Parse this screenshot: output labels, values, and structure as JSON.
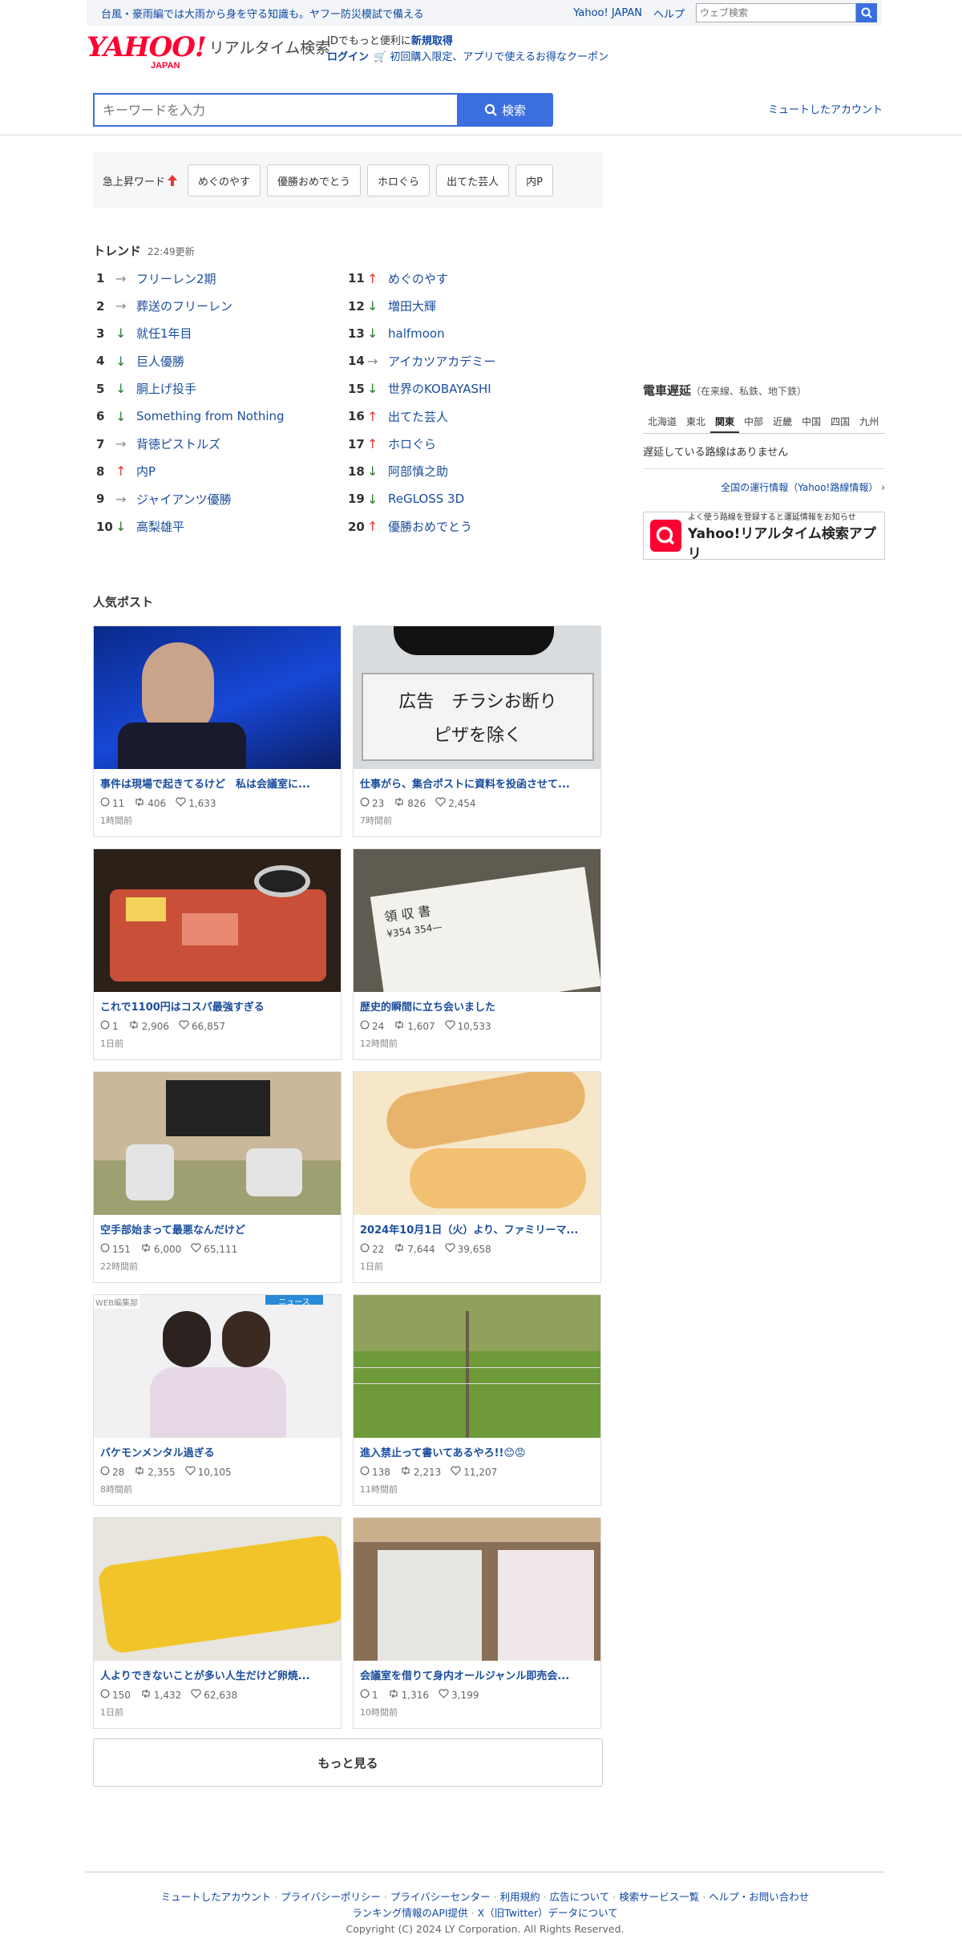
{
  "topbar": {
    "notice": "台風・豪雨編では大雨から身を守る知識も。ヤフー防災模試で備える",
    "yahoo_japan": "Yahoo! JAPAN",
    "help": "ヘルプ",
    "web_search_placeholder": "ウェブ検索"
  },
  "header": {
    "logo_yahoo": "YAHOO!",
    "logo_japan": "JAPAN",
    "logo_product": "リアルタイム検索",
    "id_prefix": "IDでもっと便利に",
    "id_register": "新規取得",
    "login": "ログイン",
    "coupon": "初回購入限定、アプリで使えるお得なクーポン"
  },
  "search": {
    "placeholder": "キーワードを入力",
    "button": "検索",
    "muted_accounts": "ミュートしたアカウント"
  },
  "rising": {
    "label": "急上昇ワード",
    "chips": [
      "めぐのやす",
      "優勝おめでとう",
      "ホロぐら",
      "出てた芸人",
      "内P"
    ]
  },
  "trends": {
    "title": "トレンド",
    "updated": "22:49更新",
    "items": [
      {
        "rank": "1",
        "dir": "flat",
        "word": "フリーレン2期"
      },
      {
        "rank": "2",
        "dir": "flat",
        "word": "葬送のフリーレン"
      },
      {
        "rank": "3",
        "dir": "down",
        "word": "就任1年目"
      },
      {
        "rank": "4",
        "dir": "down",
        "word": "巨人優勝"
      },
      {
        "rank": "5",
        "dir": "down",
        "word": "胴上げ投手"
      },
      {
        "rank": "6",
        "dir": "down",
        "word": "Something from Nothing"
      },
      {
        "rank": "7",
        "dir": "flat",
        "word": "背徳ピストルズ"
      },
      {
        "rank": "8",
        "dir": "up",
        "word": "内P"
      },
      {
        "rank": "9",
        "dir": "flat",
        "word": "ジャイアンツ優勝"
      },
      {
        "rank": "10",
        "dir": "down",
        "word": "高梨雄平"
      },
      {
        "rank": "11",
        "dir": "up",
        "word": "めぐのやす"
      },
      {
        "rank": "12",
        "dir": "down",
        "word": "増田大輝"
      },
      {
        "rank": "13",
        "dir": "down",
        "word": "halfmoon"
      },
      {
        "rank": "14",
        "dir": "flat",
        "word": "アイカツアカデミー"
      },
      {
        "rank": "15",
        "dir": "down",
        "word": "世界のKOBAYASHI"
      },
      {
        "rank": "16",
        "dir": "up",
        "word": "出てた芸人"
      },
      {
        "rank": "17",
        "dir": "up",
        "word": "ホロぐら"
      },
      {
        "rank": "18",
        "dir": "down",
        "word": "阿部慎之助"
      },
      {
        "rank": "19",
        "dir": "down",
        "word": "ReGLOSS 3D"
      },
      {
        "rank": "20",
        "dir": "up",
        "word": "優勝おめでとう"
      }
    ]
  },
  "train": {
    "title": "電車遅延",
    "subtitle": "（在来線、私鉄、地下鉄）",
    "regions": [
      "北海道",
      "東北",
      "関東",
      "中部",
      "近畿",
      "中国",
      "四国",
      "九州"
    ],
    "active_region": "関東",
    "status": "遅延している路線はありません",
    "all_info": "全国の運行情報（Yahoo!路線情報）"
  },
  "app_banner": {
    "small": "よく使う路線を登録すると運延情報をお知らせ",
    "big": "Yahoo!リアルタイム検索アプリ"
  },
  "popular": {
    "title": "人気ポスト",
    "posts": [
      {
        "title": "事件は現場で起きてるけど　私は会議室に...",
        "replies": "11",
        "reposts": "406",
        "likes": "1,633",
        "time": "1時間前",
        "img": "blue"
      },
      {
        "title": "仕事がら、集合ポストに資料を投函させて...",
        "replies": "23",
        "reposts": "826",
        "likes": "2,454",
        "time": "7時間前",
        "img": "sign"
      },
      {
        "title": "これで1100円はコスパ最強すぎる",
        "replies": "1",
        "reposts": "2,906",
        "likes": "66,857",
        "time": "1日前",
        "img": "sushi"
      },
      {
        "title": "歴史的瞬間に立ち会いました",
        "replies": "24",
        "reposts": "1,607",
        "likes": "10,533",
        "time": "12時間前",
        "img": "receipt"
      },
      {
        "title": "空手部始まって最悪なんだけど",
        "replies": "151",
        "reposts": "6,000",
        "likes": "65,111",
        "time": "22時間前",
        "img": "room"
      },
      {
        "title": "2024年10月1日（火）より、ファミリーマ...",
        "replies": "22",
        "reposts": "7,644",
        "likes": "39,658",
        "time": "1日前",
        "img": "bread"
      },
      {
        "title": "バケモンメンタル過ぎる",
        "replies": "28",
        "reposts": "2,355",
        "likes": "10,105",
        "time": "8時間前",
        "img": "girls"
      },
      {
        "title": "進入禁止って書いてあるやろ!!😊😡",
        "replies": "138",
        "reposts": "2,213",
        "likes": "11,207",
        "time": "11時間前",
        "img": "field"
      },
      {
        "title": "人よりできないことが多い人生だけど卵焼...",
        "replies": "150",
        "reposts": "1,432",
        "likes": "62,638",
        "time": "1日前",
        "img": "egg"
      },
      {
        "title": "会議室を借りて身内オールジャンル即売会...",
        "replies": "1",
        "reposts": "1,316",
        "likes": "3,199",
        "time": "10時間前",
        "img": "table"
      }
    ],
    "more": "もっと見る",
    "web_label": "WEB編集部",
    "news_label": "ニュース"
  },
  "footer": {
    "links_row1": [
      "ミュートしたアカウント",
      "プライバシーポリシー",
      "プライバシーセンター",
      "利用規約",
      "広告について",
      "検索サービス一覧",
      "ヘルプ・お問い合わせ"
    ],
    "links_row2": [
      "ランキング情報のAPI提供",
      "X（旧Twitter）データについて"
    ],
    "copyright": "Copyright (C) 2024 LY Corporation. All Rights Reserved."
  },
  "colors": {
    "accent": "#3b6fe0",
    "link": "#1a4d9c",
    "up": "#e53935",
    "down": "#2e7d32",
    "brand": "#ff0033"
  }
}
